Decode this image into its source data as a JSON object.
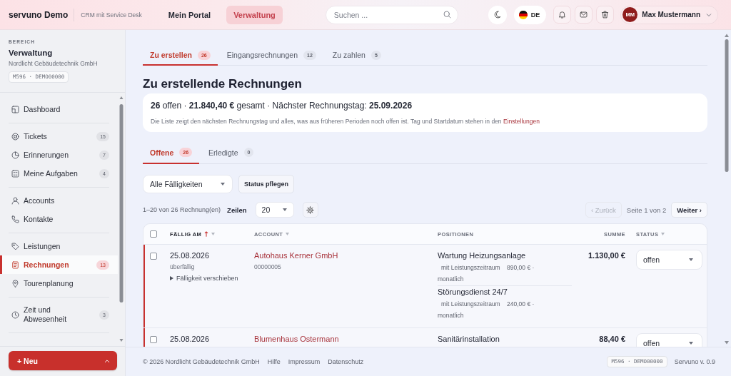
{
  "header": {
    "brand": "servuno Demo",
    "tagline": "CRM mit Service Desk",
    "nav": [
      {
        "label": "Mein Portal",
        "selected": false
      },
      {
        "label": "Verwaltung",
        "selected": true
      }
    ],
    "search": {
      "placeholder": "Suchen ..."
    },
    "language": "DE",
    "user": {
      "initials": "MM",
      "name": "Max Mustermann"
    }
  },
  "sidebar": {
    "section_label": "BEREICH",
    "section": "Verwaltung",
    "company": "Nordlicht Gebäudetechnik GmbH",
    "instance": "M596 · DEMO00000",
    "groups": [
      {
        "items": [
          {
            "label": "Dashboard",
            "selected": false
          }
        ]
      },
      {
        "items": [
          {
            "label": "Tickets",
            "count": "15",
            "selected": false
          },
          {
            "label": "Erinnerungen",
            "count": "7",
            "selected": false
          },
          {
            "label": "Meine Aufgaben",
            "count": "4",
            "selected": false
          }
        ]
      },
      {
        "items": [
          {
            "label": "Accounts",
            "selected": false
          },
          {
            "label": "Kontakte",
            "selected": false
          }
        ]
      },
      {
        "items": [
          {
            "label": "Leistungen",
            "selected": false
          },
          {
            "label": "Rechnungen",
            "count": "13",
            "selected": true
          },
          {
            "label": "Tourenplanung",
            "selected": false
          }
        ]
      },
      {
        "items": [
          {
            "label": "Zeit und Abwesenheit",
            "count": "3",
            "selected": false
          }
        ]
      }
    ],
    "new_button": "+ Neu"
  },
  "main": {
    "tabs": [
      {
        "label": "Zu erstellen",
        "count": "26",
        "selected": true
      },
      {
        "label": "Eingangsrechnungen",
        "count": "12",
        "selected": false
      },
      {
        "label": "Zu zahlen",
        "count": "5",
        "selected": false
      }
    ],
    "title": "Zu erstellende Rechnungen",
    "summary": {
      "headline": "**26** offen · **21.840,40 €** gesamt · Nächster Rechnungstag: **25.09.2026**",
      "note": "Die Liste zeigt den nächsten Rechnungstag und alles, was aus früheren Perioden noch offen ist. Tag und Startdatum stehen in den",
      "note_link": "Einstellungen"
    },
    "subtabs": [
      {
        "label": "Offene",
        "count": "26",
        "selected": true
      },
      {
        "label": "Erledigte",
        "count": "0",
        "selected": false
      }
    ],
    "filter": {
      "value": "Alle Fälligkeiten"
    },
    "status_button": "Status pflegen",
    "pager": {
      "range": "1–20 von 26 Rechnung(en)",
      "rows_label": "Zeilen",
      "rows_value": "20",
      "prev": {
        "label": "‹ Zurück",
        "disabled": true
      },
      "page": "Seite 1 von 2",
      "next": {
        "label": "Weiter ›",
        "disabled": false
      }
    },
    "table": {
      "header_checkbox": {
        "checked": false
      },
      "columns": [
        {
          "label": "FÄLLIG AM",
          "kind": "date",
          "sorted": true,
          "filter": true
        },
        {
          "label": "ACCOUNT",
          "kind": "account",
          "sorted": false,
          "filter": true
        },
        {
          "label": "POSITIONEN",
          "kind": "positions",
          "sorted": false,
          "filter": false
        },
        {
          "label": "SUMME",
          "kind": "amount",
          "sorted": false,
          "filter": false
        },
        {
          "label": "STATUS",
          "kind": "status",
          "sorted": false,
          "filter": true
        }
      ],
      "rows": [
        {
          "checked": false,
          "overdue": true,
          "due_date": "25.08.2026",
          "due_note": "überfällig",
          "postpone": {
            "label": "Fälligkeit verschieben",
            "expanded": false
          },
          "account": {
            "name": "Autohaus Kerner GmbH",
            "number": "00000005"
          },
          "positions": [
            {
              "name": "Wartung Heizungsanlage",
              "detail": "mit Leistungszeitraum",
              "price": "890,00 € · monatlich"
            },
            {
              "name": "Störungsdienst 24/7",
              "detail": "mit Leistungszeitraum",
              "price": "240,00 € · monatlich"
            }
          ],
          "total": "1.130,00 €",
          "status": "offen"
        },
        {
          "checked": false,
          "overdue": true,
          "due_date": "25.08.2026",
          "account": {
            "name": "Blumenhaus Ostermann"
          },
          "positions": [
            {
              "name": "Sanitärinstallation"
            }
          ],
          "total": "88,40 €",
          "status": "offen"
        }
      ]
    }
  },
  "footer": {
    "copyright": "© 2026 Nordlicht Gebäudetechnik GmbH",
    "links": [
      "Hilfe",
      "Impressum",
      "Datenschutz"
    ],
    "instance": "M596 · DEMO00000",
    "version": "Servuno v. 0.9"
  }
}
